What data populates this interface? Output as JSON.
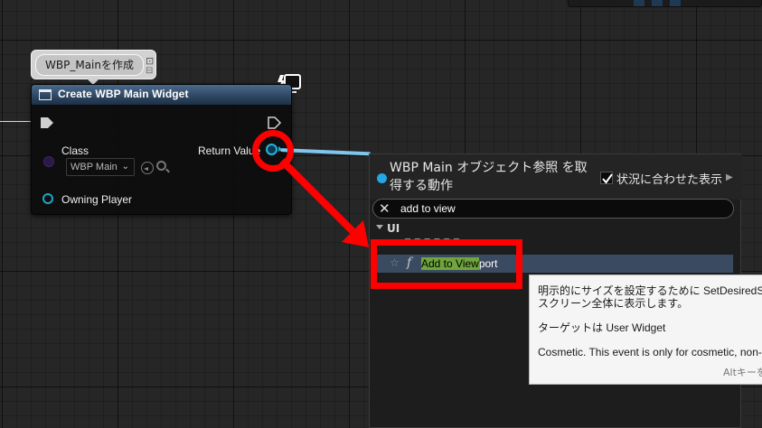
{
  "comment": {
    "text": "WBP_Mainを作成"
  },
  "node": {
    "title": "Create WBP Main Widget",
    "class_label": "Class",
    "class_value": "WBP Main",
    "return_label": "Return Value",
    "owning_label": "Owning Player"
  },
  "popup": {
    "title": "WBP Main オブジェクト参照 を取得する動作",
    "context_sensitive_label": "状況に合わせた表示",
    "context_sensitive_checked": true,
    "search_value": "add to view",
    "category": "UI",
    "result": {
      "match": "Add to View",
      "rest": "port"
    }
  },
  "tooltip": {
    "line1": "明示的にサイズを設定するために SetDesiredSiz",
    "line2": "スクリーン全体に表示します。",
    "line3": "ターゲットは User Widget",
    "line4": "Cosmetic. This event is only for cosmetic, non-",
    "hint": "Altキーを"
  },
  "colors": {
    "annotation": "#ff0000",
    "object_ref_pin": "#2bb0e0",
    "header_blue": "#2d4560",
    "search_highlight": "#6fa53c",
    "selected_row": "#3a4a60"
  }
}
